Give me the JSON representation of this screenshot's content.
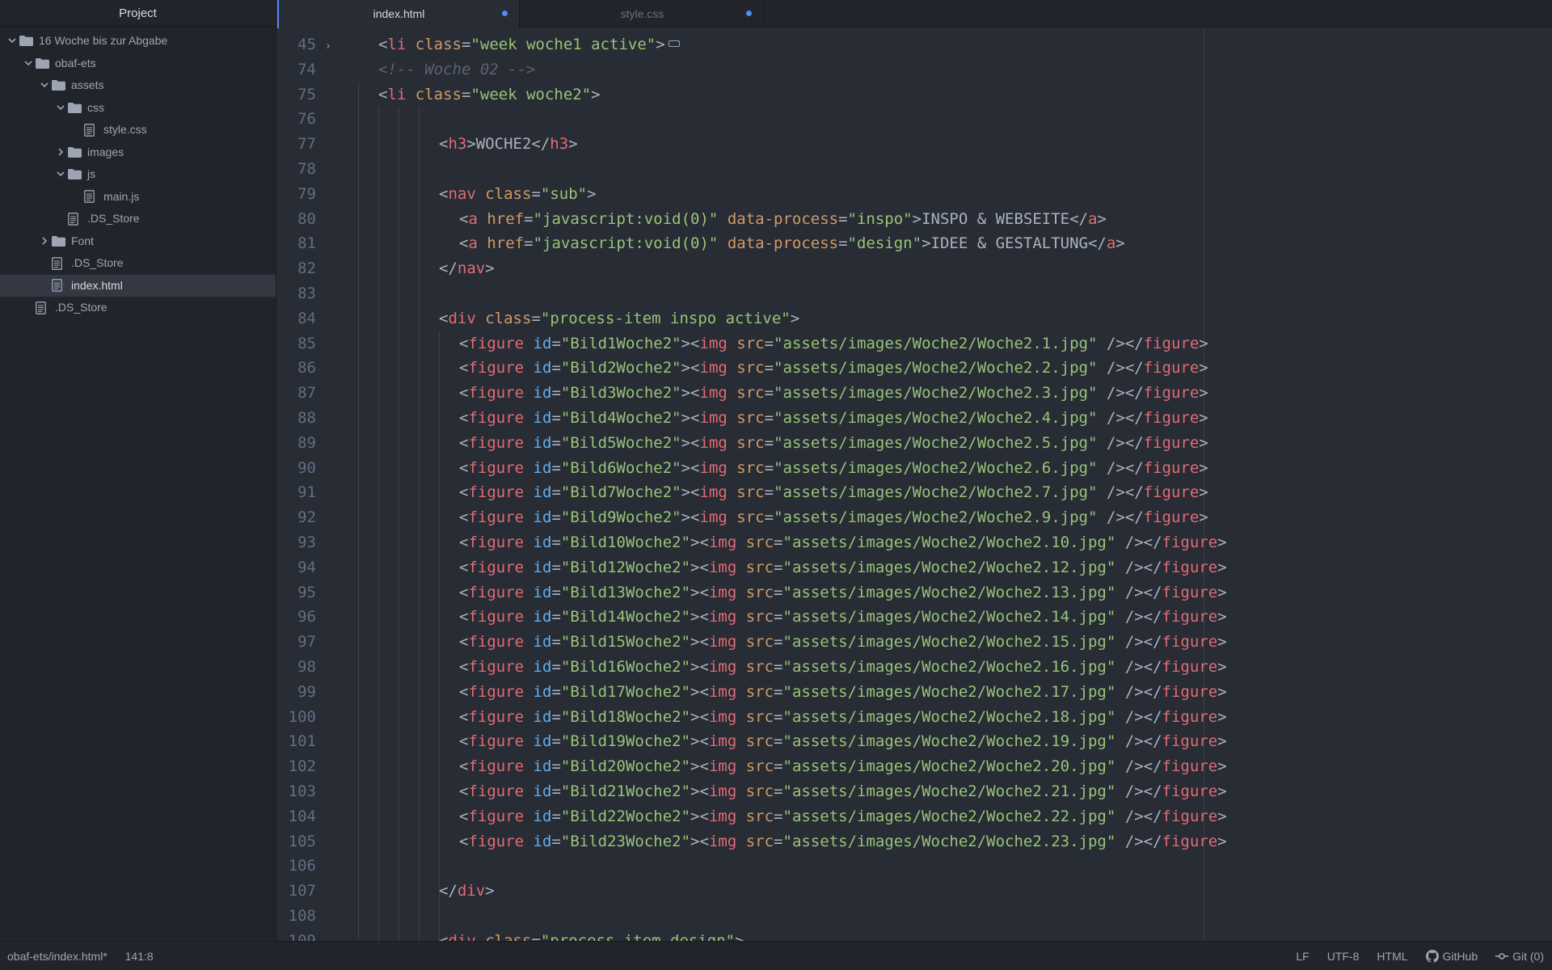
{
  "sidebar": {
    "title": "Project",
    "items": [
      {
        "label": "16 Woche bis zur Abgabe",
        "type": "folder",
        "depth": 0,
        "expanded": true
      },
      {
        "label": "obaf-ets",
        "type": "folder",
        "depth": 1,
        "expanded": true
      },
      {
        "label": "assets",
        "type": "folder",
        "depth": 2,
        "expanded": true
      },
      {
        "label": "css",
        "type": "folder",
        "depth": 3,
        "expanded": true
      },
      {
        "label": "style.css",
        "type": "file",
        "depth": 4
      },
      {
        "label": "images",
        "type": "folder",
        "depth": 3,
        "expanded": false
      },
      {
        "label": "js",
        "type": "folder",
        "depth": 3,
        "expanded": true
      },
      {
        "label": "main.js",
        "type": "file",
        "depth": 4
      },
      {
        "label": ".DS_Store",
        "type": "file",
        "depth": 3
      },
      {
        "label": "Font",
        "type": "folder",
        "depth": 2,
        "expanded": false
      },
      {
        "label": ".DS_Store",
        "type": "file",
        "depth": 2
      },
      {
        "label": "index.html",
        "type": "file",
        "depth": 2,
        "selected": true
      },
      {
        "label": ".DS_Store",
        "type": "file",
        "depth": 1
      }
    ]
  },
  "tabs": [
    {
      "label": "index.html",
      "active": true,
      "modified": true
    },
    {
      "label": "style.css",
      "active": false,
      "modified": true
    }
  ],
  "editor": {
    "lines": [
      {
        "n": "45",
        "fold": true,
        "indent": 1,
        "tokens": [
          [
            "t-txt",
            "<"
          ],
          [
            "t-tag",
            "li"
          ],
          [
            "t-txt",
            " "
          ],
          [
            "t-attr",
            "class"
          ],
          [
            "t-txt",
            "="
          ],
          [
            "t-str",
            "\"week woche1 active\""
          ],
          [
            "t-txt",
            ">"
          ]
        ],
        "folded": true
      },
      {
        "n": "74",
        "indent": 1,
        "tokens": [
          [
            "t-com",
            "<!-- Woche 02 -->"
          ]
        ]
      },
      {
        "n": "75",
        "indent": 1,
        "tokens": [
          [
            "t-txt",
            "<"
          ],
          [
            "t-tag",
            "li"
          ],
          [
            "t-txt",
            " "
          ],
          [
            "t-attr",
            "class"
          ],
          [
            "t-txt",
            "="
          ],
          [
            "t-str",
            "\"week woche2\""
          ],
          [
            "t-txt",
            ">"
          ]
        ]
      },
      {
        "n": "76",
        "indent": 1,
        "tokens": []
      },
      {
        "n": "77",
        "indent": 4,
        "tokens": [
          [
            "t-txt",
            "<"
          ],
          [
            "t-tag",
            "h3"
          ],
          [
            "t-txt",
            ">WOCHE2</"
          ],
          [
            "t-tag",
            "h3"
          ],
          [
            "t-txt",
            ">"
          ]
        ]
      },
      {
        "n": "78",
        "indent": 4,
        "tokens": []
      },
      {
        "n": "79",
        "indent": 4,
        "tokens": [
          [
            "t-txt",
            "<"
          ],
          [
            "t-tag",
            "nav"
          ],
          [
            "t-txt",
            " "
          ],
          [
            "t-attr",
            "class"
          ],
          [
            "t-txt",
            "="
          ],
          [
            "t-str",
            "\"sub\""
          ],
          [
            "t-txt",
            ">"
          ]
        ]
      },
      {
        "n": "80",
        "indent": 5,
        "tokens": [
          [
            "t-txt",
            "<"
          ],
          [
            "t-tag",
            "a"
          ],
          [
            "t-txt",
            " "
          ],
          [
            "t-attr",
            "href"
          ],
          [
            "t-txt",
            "="
          ],
          [
            "t-str",
            "\"javascript:void(0)\""
          ],
          [
            "t-txt",
            " "
          ],
          [
            "t-attr",
            "data-process"
          ],
          [
            "t-txt",
            "="
          ],
          [
            "t-str",
            "\"inspo\""
          ],
          [
            "t-txt",
            ">INSPO & WEBSEITE</"
          ],
          [
            "t-tag",
            "a"
          ],
          [
            "t-txt",
            ">"
          ]
        ]
      },
      {
        "n": "81",
        "indent": 5,
        "tokens": [
          [
            "t-txt",
            "<"
          ],
          [
            "t-tag",
            "a"
          ],
          [
            "t-txt",
            " "
          ],
          [
            "t-attr",
            "href"
          ],
          [
            "t-txt",
            "="
          ],
          [
            "t-str",
            "\"javascript:void(0)\""
          ],
          [
            "t-txt",
            " "
          ],
          [
            "t-attr",
            "data-process"
          ],
          [
            "t-txt",
            "="
          ],
          [
            "t-str",
            "\"design\""
          ],
          [
            "t-txt",
            ">IDEE & GESTALTUNG</"
          ],
          [
            "t-tag",
            "a"
          ],
          [
            "t-txt",
            ">"
          ]
        ]
      },
      {
        "n": "82",
        "indent": 4,
        "tokens": [
          [
            "t-txt",
            "</"
          ],
          [
            "t-tag",
            "nav"
          ],
          [
            "t-txt",
            ">"
          ]
        ]
      },
      {
        "n": "83",
        "indent": 4,
        "tokens": []
      },
      {
        "n": "84",
        "indent": 4,
        "tokens": [
          [
            "t-txt",
            "<"
          ],
          [
            "t-tag",
            "div"
          ],
          [
            "t-txt",
            " "
          ],
          [
            "t-attr",
            "class"
          ],
          [
            "t-txt",
            "="
          ],
          [
            "t-str",
            "\"process-item inspo active\""
          ],
          [
            "t-txt",
            ">"
          ]
        ]
      },
      {
        "n": "85",
        "indent": 5,
        "fig": [
          "Bild1Woche2",
          "Woche2.1.jpg"
        ]
      },
      {
        "n": "86",
        "indent": 5,
        "fig": [
          "Bild2Woche2",
          "Woche2.2.jpg"
        ]
      },
      {
        "n": "87",
        "indent": 5,
        "fig": [
          "Bild3Woche2",
          "Woche2.3.jpg"
        ]
      },
      {
        "n": "88",
        "indent": 5,
        "fig": [
          "Bild4Woche2",
          "Woche2.4.jpg"
        ]
      },
      {
        "n": "89",
        "indent": 5,
        "fig": [
          "Bild5Woche2",
          "Woche2.5.jpg"
        ]
      },
      {
        "n": "90",
        "indent": 5,
        "fig": [
          "Bild6Woche2",
          "Woche2.6.jpg"
        ]
      },
      {
        "n": "91",
        "indent": 5,
        "fig": [
          "Bild7Woche2",
          "Woche2.7.jpg"
        ]
      },
      {
        "n": "92",
        "indent": 5,
        "fig": [
          "Bild9Woche2",
          "Woche2.9.jpg"
        ]
      },
      {
        "n": "93",
        "indent": 5,
        "fig": [
          "Bild10Woche2",
          "Woche2.10.jpg"
        ]
      },
      {
        "n": "94",
        "indent": 5,
        "fig": [
          "Bild12Woche2",
          "Woche2.12.jpg"
        ]
      },
      {
        "n": "95",
        "indent": 5,
        "fig": [
          "Bild13Woche2",
          "Woche2.13.jpg"
        ]
      },
      {
        "n": "96",
        "indent": 5,
        "fig": [
          "Bild14Woche2",
          "Woche2.14.jpg"
        ]
      },
      {
        "n": "97",
        "indent": 5,
        "fig": [
          "Bild15Woche2",
          "Woche2.15.jpg"
        ]
      },
      {
        "n": "98",
        "indent": 5,
        "fig": [
          "Bild16Woche2",
          "Woche2.16.jpg"
        ]
      },
      {
        "n": "99",
        "indent": 5,
        "fig": [
          "Bild17Woche2",
          "Woche2.17.jpg"
        ]
      },
      {
        "n": "100",
        "indent": 5,
        "fig": [
          "Bild18Woche2",
          "Woche2.18.jpg"
        ]
      },
      {
        "n": "101",
        "indent": 5,
        "fig": [
          "Bild19Woche2",
          "Woche2.19.jpg"
        ]
      },
      {
        "n": "102",
        "indent": 5,
        "fig": [
          "Bild20Woche2",
          "Woche2.20.jpg"
        ]
      },
      {
        "n": "103",
        "indent": 5,
        "fig": [
          "Bild21Woche2",
          "Woche2.21.jpg"
        ]
      },
      {
        "n": "104",
        "indent": 5,
        "fig": [
          "Bild22Woche2",
          "Woche2.22.jpg"
        ]
      },
      {
        "n": "105",
        "indent": 5,
        "fig": [
          "Bild23Woche2",
          "Woche2.23.jpg"
        ]
      },
      {
        "n": "106",
        "indent": 4,
        "tokens": []
      },
      {
        "n": "107",
        "indent": 4,
        "tokens": [
          [
            "t-txt",
            "</"
          ],
          [
            "t-tag",
            "div"
          ],
          [
            "t-txt",
            ">"
          ]
        ]
      },
      {
        "n": "108",
        "indent": 4,
        "tokens": []
      },
      {
        "n": "109",
        "indent": 4,
        "tokens": [
          [
            "t-txt",
            "<"
          ],
          [
            "t-tag",
            "div"
          ],
          [
            "t-txt",
            " "
          ],
          [
            "t-attr",
            "class"
          ],
          [
            "t-txt",
            "="
          ],
          [
            "t-str",
            "\"process-item design\""
          ],
          [
            "t-txt",
            ">"
          ]
        ]
      }
    ],
    "figure_image_dir": "assets/images/Woche2/"
  },
  "statusbar": {
    "path": "obaf-ets/index.html*",
    "cursor": "141:8",
    "line_ending": "LF",
    "encoding": "UTF-8",
    "grammar": "HTML",
    "github": "GitHub",
    "git": "Git (0)"
  },
  "colors": {
    "accent": "#568af2",
    "tag": "#e06c75",
    "attr": "#d19a66",
    "id": "#61afef",
    "string": "#98c379",
    "comment": "#5c6370"
  }
}
